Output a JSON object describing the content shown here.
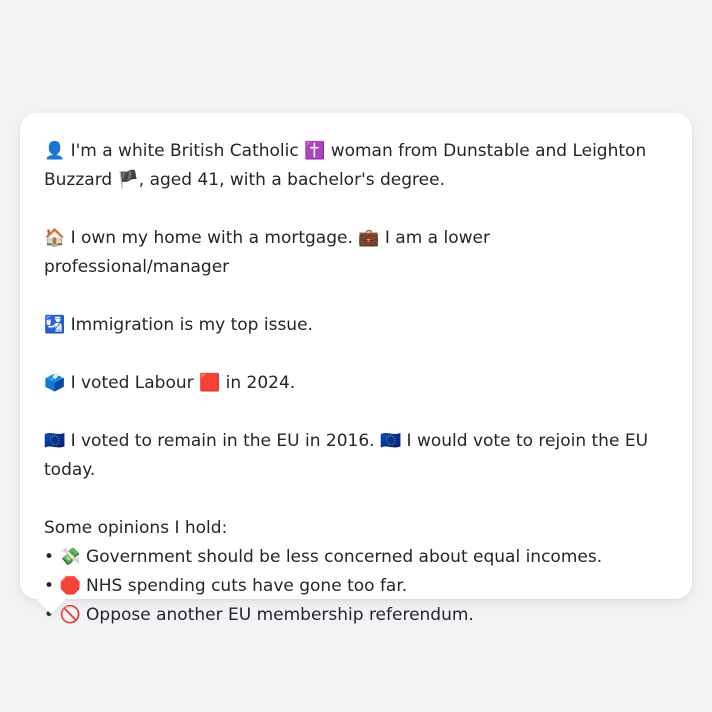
{
  "profile": {
    "identity": {
      "icon": "👤",
      "text_a": "I'm a white British Catholic",
      "religion_icon": "✝️",
      "text_b": "woman from Dunstable and Leighton Buzzard",
      "flag_icon": "🏴",
      "text_c": ", aged 41, with a bachelor's degree."
    },
    "home": {
      "house_icon": "🏠",
      "home_text": "I own my home with a mortgage.",
      "job_icon": "💼",
      "job_text": "I am a lower professional/manager"
    },
    "issue": {
      "icon": "🛂",
      "text": "Immigration is my top issue."
    },
    "vote": {
      "ballot_icon": "🗳️",
      "text_a": "I voted Labour",
      "party_icon": "🟥",
      "text_b": "in 2024."
    },
    "eu": {
      "icon_1": "🇪🇺",
      "text_a": "I voted to remain in the EU in 2016.",
      "icon_2": "🇪🇺",
      "text_b": "I would vote to rejoin the EU today."
    },
    "opinions": {
      "heading": "Some opinions I hold:",
      "bullet": "•",
      "items": [
        {
          "icon": "💸",
          "text": "Government should be less concerned about equal incomes."
        },
        {
          "icon": "🛑",
          "text": "NHS spending cuts have gone too far."
        },
        {
          "icon": "🚫",
          "text": "Oppose another EU membership referendum."
        }
      ]
    }
  }
}
